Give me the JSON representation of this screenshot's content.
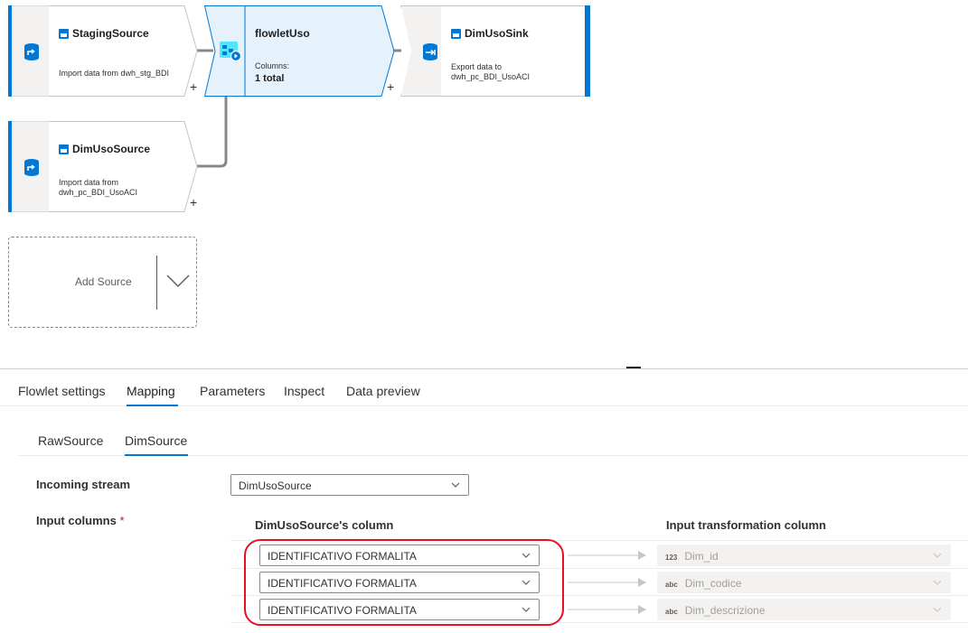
{
  "graph": {
    "nodes": {
      "staging_source": {
        "title": "StagingSource",
        "description_lines": [
          "Import data from dwh_stg_BDI"
        ]
      },
      "flowlet": {
        "title": "flowletUso",
        "columns_label": "Columns:",
        "columns_value": "1 total"
      },
      "sink": {
        "title": "DimUsoSink",
        "description_lines": [
          "Export data to",
          "dwh_pc_BDI_UsoACI"
        ]
      },
      "dim_source": {
        "title": "DimUsoSource",
        "description_lines": [
          "Import data from",
          "dwh_pc_BDI_UsoACI"
        ]
      }
    },
    "plus_label": "+",
    "add_source_label": "Add Source"
  },
  "tabs": [
    {
      "label": "Flowlet settings",
      "active": false
    },
    {
      "label": "Mapping",
      "active": true
    },
    {
      "label": "Parameters",
      "active": false
    },
    {
      "label": "Inspect",
      "active": false
    },
    {
      "label": "Data preview",
      "active": false
    }
  ],
  "subtabs": [
    {
      "label": "RawSource",
      "active": false
    },
    {
      "label": "DimSource",
      "active": true
    }
  ],
  "form": {
    "incoming_stream_label": "Incoming stream",
    "incoming_stream_value": "DimUsoSource",
    "input_columns_label": "Input columns",
    "required_marker": "*",
    "source_column_header": "DimUsoSource's column",
    "target_column_header": "Input transformation column",
    "mappings": [
      {
        "source": "IDENTIFICATIVO FORMALITA",
        "target_type": "123",
        "target": "Dim_id"
      },
      {
        "source": "IDENTIFICATIVO FORMALITA",
        "target_type": "abc",
        "target": "Dim_codice"
      },
      {
        "source": "IDENTIFICATIVO FORMALITA",
        "target_type": "abc",
        "target": "Dim_descrizione"
      }
    ]
  },
  "colors": {
    "accent": "#0078d4",
    "node_border": "#c8c6c4",
    "selected_fill": "#deecf9",
    "highlight": "#e81123"
  },
  "icons": [
    "import-source-icon",
    "flowlet-icon",
    "sink-icon",
    "table-icon",
    "chevron-down-icon",
    "arrow-right-icon"
  ]
}
